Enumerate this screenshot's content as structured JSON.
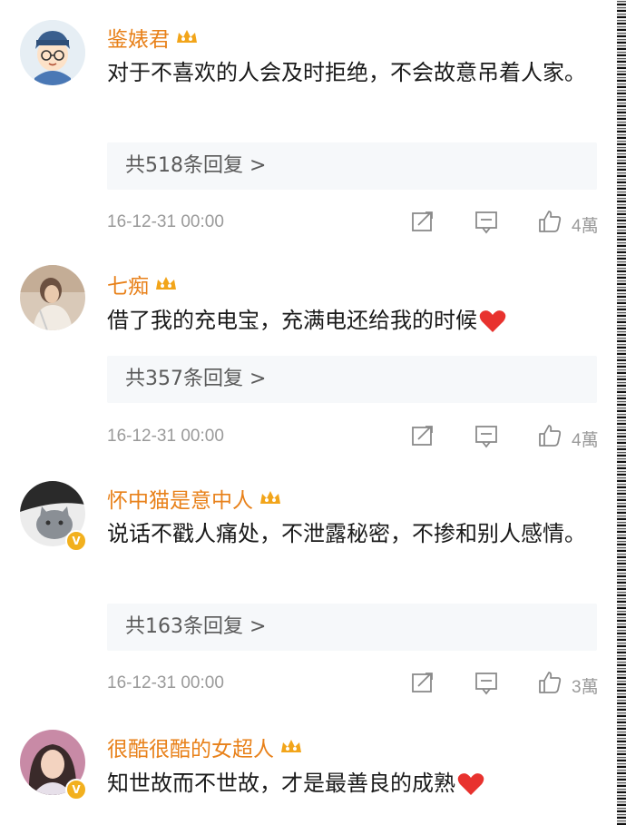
{
  "colors": {
    "username": "#e8811a",
    "badge": "#f2b01e",
    "heart": "#e8322e",
    "reply_bg": "#f6f8fa",
    "meta": "#9a9a9a"
  },
  "comments": [
    {
      "username": "鉴婊君",
      "avatar": "cartoon-boy-avatar",
      "text": "对于不喜欢的人会及时拒绝，不会故意吊着人家。",
      "heart": false,
      "replies": "共518条回复 >",
      "time": "16-12-31 00:00",
      "likes": "4萬"
    },
    {
      "username": "七痴",
      "avatar": "photo-avatar",
      "text": "借了我的充电宝，充满电还给我的时候",
      "heart": true,
      "replies": "共357条回复 >",
      "time": "16-12-31 00:00",
      "likes": "4萬"
    },
    {
      "username": "怀中猫是意中人",
      "avatar": "cat-photo-avatar",
      "verified": true,
      "text": "说话不戳人痛处，不泄露秘密，不掺和别人感情。",
      "heart": false,
      "replies": "共163条回复 >",
      "time": "16-12-31 00:00",
      "likes": "3萬"
    },
    {
      "username": "很酷很酷的女超人",
      "avatar": "girl-photo-avatar",
      "verified": true,
      "text": "知世故而不世故，才是最善良的成熟",
      "heart": true
    }
  ]
}
